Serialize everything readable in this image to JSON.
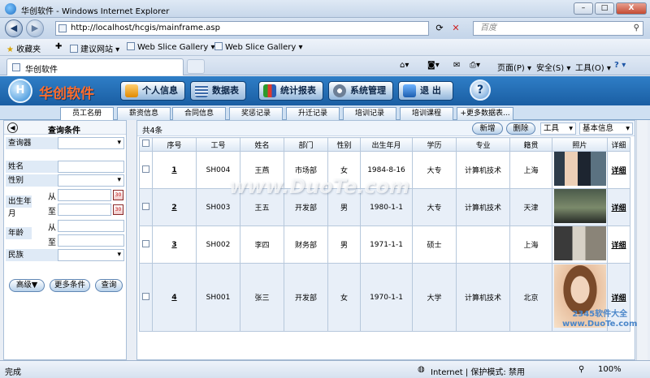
{
  "window": {
    "title": "华创软件 - Windows Internet Explorer",
    "min": "–",
    "max": "□",
    "close": "X"
  },
  "address": {
    "url": "http://localhost/hcgis/mainframe.asp",
    "search_placeholder": "百度"
  },
  "favorites": {
    "label": "收藏夹",
    "items": [
      "建议网站 ▾",
      "Web Slice Gallery ▾",
      "Web Slice Gallery ▾"
    ]
  },
  "browser_tab": {
    "label": "华创软件"
  },
  "commandbar": {
    "page": "页面(P) ▾",
    "safety": "安全(S) ▾",
    "tools": "工具(O) ▾",
    "help": "? ▾"
  },
  "app": {
    "logo_mark": "H",
    "logo_text": "华创软件",
    "nav": [
      "个人信息",
      "数据表",
      "统计报表",
      "系统管理",
      "退 出"
    ],
    "help": "?"
  },
  "tabs": [
    "员工名册",
    "薪资信息",
    "合同信息",
    "奖惩记录",
    "升迁记录",
    "培训记录",
    "培训课程",
    "+更多数据表..."
  ],
  "query": {
    "title": "查询条件",
    "fields": {
      "query_builder": "查询器",
      "name": "姓名",
      "gender": "性别",
      "birth": "出生年月",
      "from": "从",
      "to": "至",
      "age": "年龄",
      "ethnicity": "民族"
    },
    "buttons": {
      "advanced": "高级▼",
      "more": "更多条件",
      "search": "查询"
    }
  },
  "grid": {
    "count_label": "共4条",
    "buttons": {
      "add": "新增",
      "delete": "删除"
    },
    "tools_select": "工具",
    "info_select": "基本信息",
    "headers": [
      "序号",
      "工号",
      "姓名",
      "部门",
      "性别",
      "出生年月",
      "学历",
      "专业",
      "籍贯",
      "照片",
      "详细"
    ],
    "rows": [
      {
        "no": "1",
        "id": "SH004",
        "name": "王燕",
        "dept": "市场部",
        "gender": "女",
        "birth": "1984-8-16",
        "edu": "大专",
        "major": "计算机技术",
        "place": "上海",
        "detail": "详细"
      },
      {
        "no": "2",
        "id": "SH003",
        "name": "王五",
        "dept": "开发部",
        "gender": "男",
        "birth": "1980-1-1",
        "edu": "大专",
        "major": "计算机技术",
        "place": "天津",
        "detail": "详细"
      },
      {
        "no": "3",
        "id": "SH002",
        "name": "李四",
        "dept": "财务部",
        "gender": "男",
        "birth": "1971-1-1",
        "edu": "硕士",
        "major": "",
        "place": "上海",
        "detail": "详细"
      },
      {
        "no": "4",
        "id": "SH001",
        "name": "张三",
        "dept": "开发部",
        "gender": "女",
        "birth": "1970-1-1",
        "edu": "大学",
        "major": "计算机技术",
        "place": "北京",
        "detail": "详细"
      }
    ]
  },
  "status": {
    "left": "完成",
    "zone": "Internet | 保护模式: 禁用",
    "zoom": "100%"
  },
  "watermark": {
    "main": "www.DuoTe.com",
    "corner_top": "2345软件大全",
    "corner_bottom": "www.DuoTe.com"
  },
  "colors": {
    "header_blue": "#1f66ad",
    "logo_orange": "#ff6d2d",
    "row_alt": "#e8eff8"
  }
}
